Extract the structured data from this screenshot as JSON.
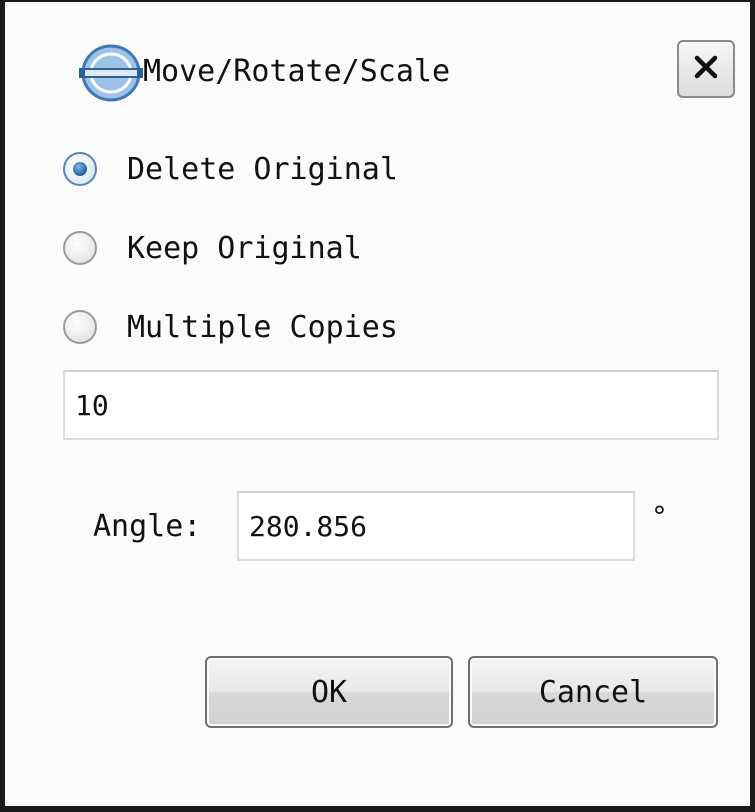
{
  "window": {
    "title": "Move/Rotate/Scale",
    "close_label": "✕"
  },
  "options": {
    "delete_original": "Delete Original",
    "keep_original": "Keep Original",
    "multiple_copies": "Multiple Copies",
    "selected": "delete_original"
  },
  "copies": {
    "value": "10"
  },
  "angle": {
    "label": "Angle:",
    "value": "280.856",
    "unit": "°"
  },
  "buttons": {
    "ok": "OK",
    "cancel": "Cancel"
  },
  "colors": {
    "accent": "#1f5e9c",
    "dialog_bg": "#fbfbfb",
    "border": "#1a1a1a"
  }
}
